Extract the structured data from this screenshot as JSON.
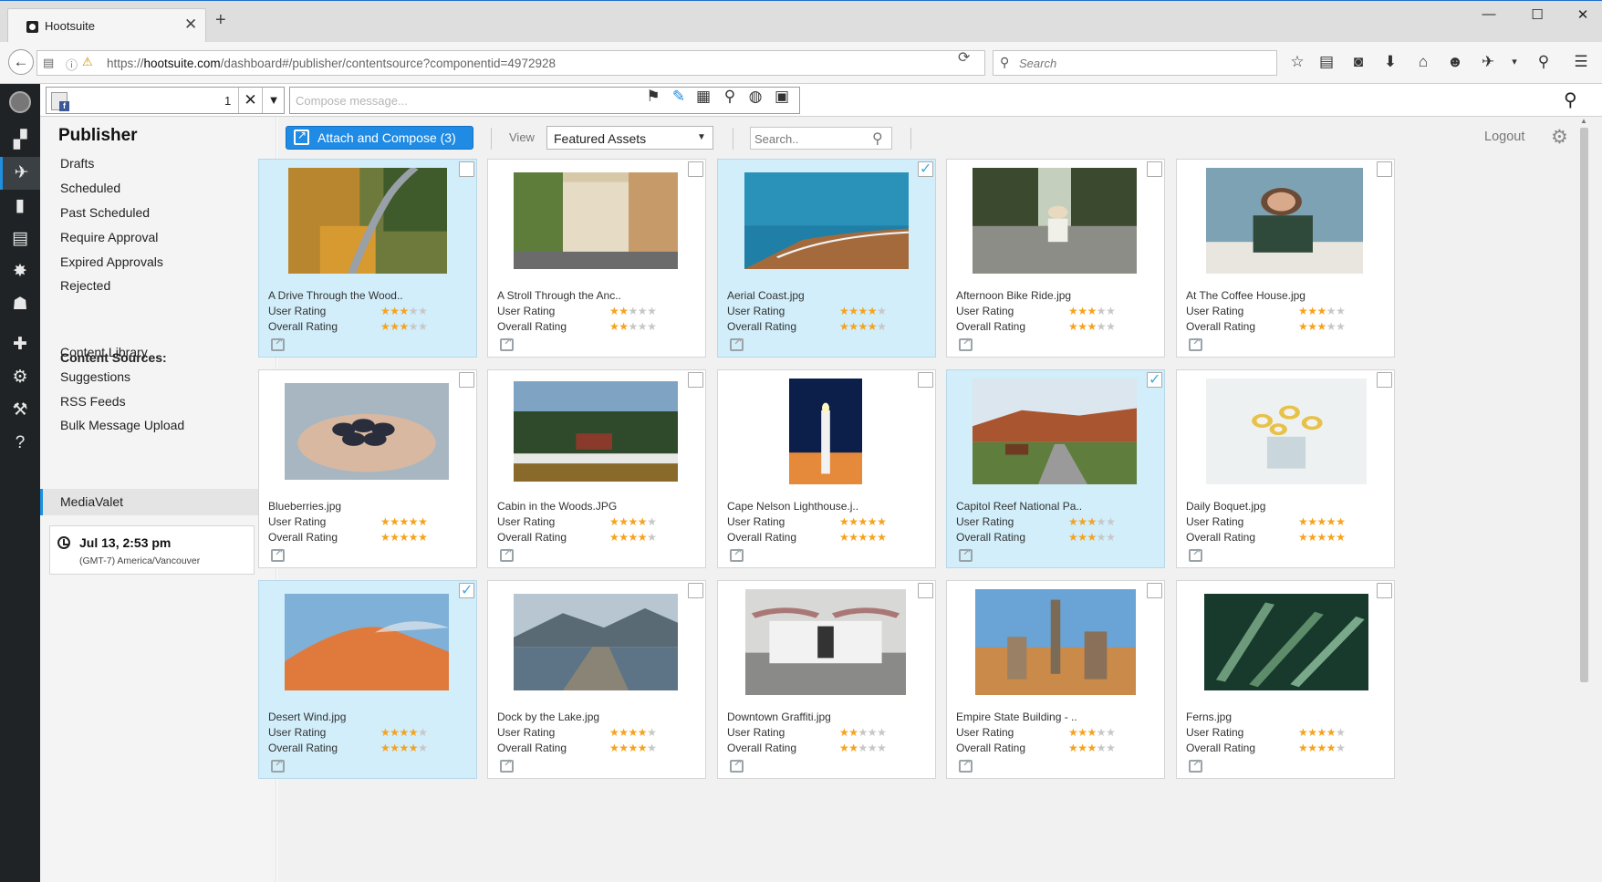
{
  "browser": {
    "tab_title": "Hootsuite",
    "url_prefix": "https://",
    "url_host": "hootsuite.com",
    "url_path": "/dashboard#/publisher/contentsource?componentid=4972928",
    "search_placeholder": "Search"
  },
  "compose": {
    "profile_count": "1",
    "placeholder": "Compose message..."
  },
  "sidebar": {
    "title": "Publisher",
    "items": [
      "Drafts",
      "Scheduled",
      "Past Scheduled",
      "Require Approval",
      "Expired Approvals",
      "Rejected"
    ],
    "content_sources_heading": "Content Sources:",
    "sources": [
      "Content Library",
      "Suggestions",
      "RSS Feeds",
      "Bulk Message Upload"
    ],
    "active_source": "MediaValet",
    "time": "Jul 13, 2:53 pm",
    "timezone": "(GMT-7) America/Vancouver"
  },
  "toolbar": {
    "attach_label": "Attach and Compose (3)",
    "view_label": "View",
    "view_value": "Featured Assets",
    "search_placeholder": "Search..",
    "logout": "Logout"
  },
  "labels": {
    "user_rating": "User Rating",
    "overall_rating": "Overall Rating"
  },
  "colors": {
    "accent": "#1f8be4",
    "selected_card": "#d1eefa",
    "star": "#f7a21b",
    "rail": "#1f2325"
  },
  "assets": [
    {
      "name": "A Drive Through the Wood..",
      "user_rating": 3,
      "overall_rating": 3,
      "selected": true,
      "checked": false
    },
    {
      "name": "A Stroll Through the Anc..",
      "user_rating": 2,
      "overall_rating": 2,
      "selected": false,
      "checked": false
    },
    {
      "name": "Aerial Coast.jpg",
      "user_rating": 4,
      "overall_rating": 4,
      "selected": true,
      "checked": true
    },
    {
      "name": "Afternoon Bike Ride.jpg",
      "user_rating": 3,
      "overall_rating": 3,
      "selected": false,
      "checked": false
    },
    {
      "name": "At The Coffee House.jpg",
      "user_rating": 3,
      "overall_rating": 3,
      "selected": false,
      "checked": false
    },
    {
      "name": "Blueberries.jpg",
      "user_rating": 5,
      "overall_rating": 5,
      "selected": false,
      "checked": false
    },
    {
      "name": "Cabin in the Woods.JPG",
      "user_rating": 4,
      "overall_rating": 4,
      "selected": false,
      "checked": false
    },
    {
      "name": "Cape Nelson Lighthouse.j..",
      "user_rating": 5,
      "overall_rating": 5,
      "selected": false,
      "checked": false
    },
    {
      "name": "Capitol Reef National Pa..",
      "user_rating": 3,
      "overall_rating": 3,
      "selected": true,
      "checked": true
    },
    {
      "name": "Daily Boquet.jpg",
      "user_rating": 5,
      "overall_rating": 5,
      "selected": false,
      "checked": false
    },
    {
      "name": "Desert Wind.jpg",
      "user_rating": 4,
      "overall_rating": 4,
      "selected": true,
      "checked": true
    },
    {
      "name": "Dock by the Lake.jpg",
      "user_rating": 4,
      "overall_rating": 4,
      "selected": false,
      "checked": false
    },
    {
      "name": "Downtown Graffiti.jpg",
      "user_rating": 2,
      "overall_rating": 2,
      "selected": false,
      "checked": false
    },
    {
      "name": "Empire State Building - ..",
      "user_rating": 3,
      "overall_rating": 3,
      "selected": false,
      "checked": false
    },
    {
      "name": "Ferns.jpg",
      "user_rating": 4,
      "overall_rating": 4,
      "selected": false,
      "checked": false
    }
  ]
}
